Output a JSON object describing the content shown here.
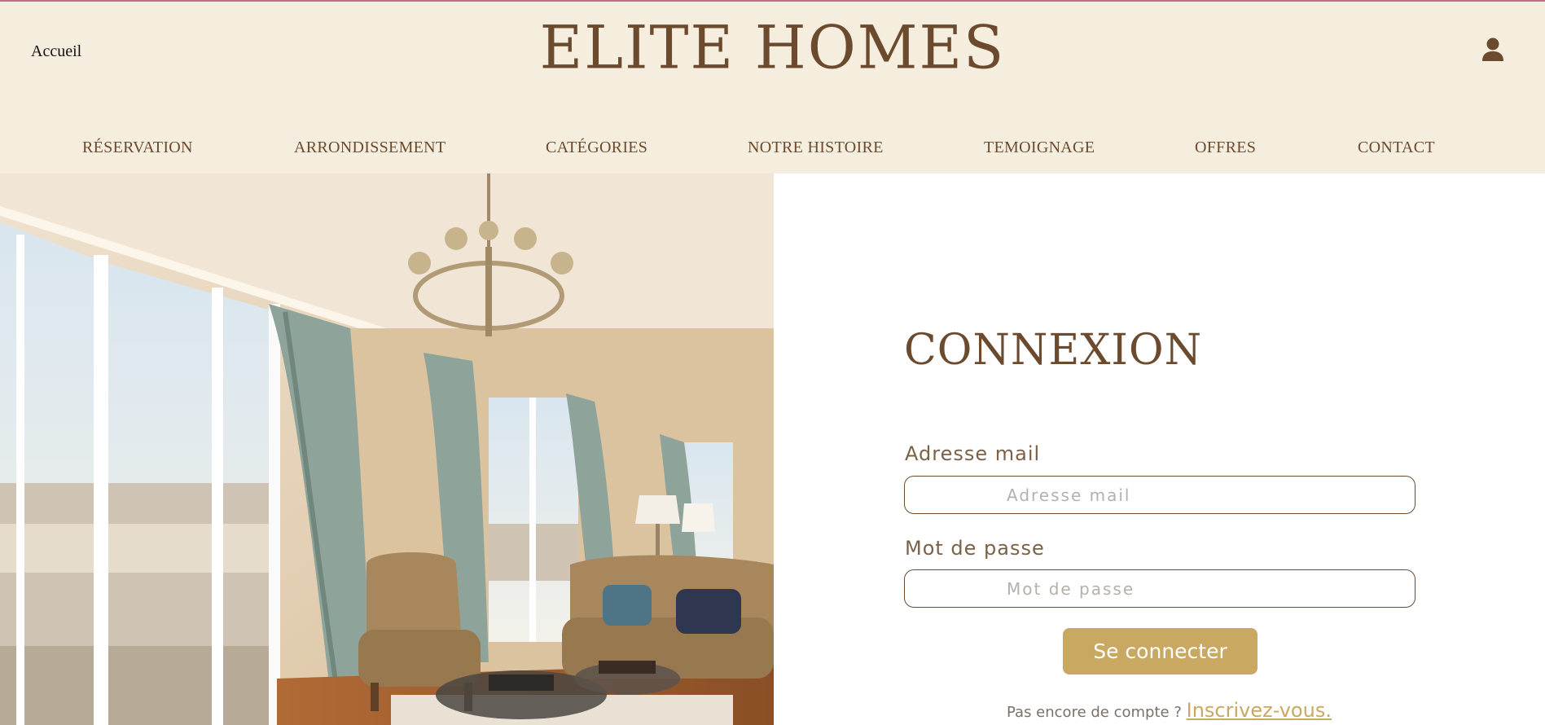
{
  "header": {
    "home_link": "Accueil",
    "logo": "ELITE HOMES",
    "account_icon": "user-icon"
  },
  "nav": {
    "items": [
      {
        "label": "RÉSERVATION"
      },
      {
        "label": "ARRONDISSEMENT"
      },
      {
        "label": "CATÉGORIES"
      },
      {
        "label": "NOTRE HISTOIRE"
      },
      {
        "label": "TEMOIGNAGE"
      },
      {
        "label": "OFFRES"
      },
      {
        "label": "CONTACT"
      }
    ]
  },
  "login": {
    "title": "CONNEXION",
    "email_label": "Adresse mail",
    "email_placeholder": "Adresse mail",
    "email_value": "",
    "password_label": "Mot de passe",
    "password_placeholder": "Mot de passe",
    "password_value": "",
    "submit_label": "Se connecter",
    "signup_prompt": "Pas encore de compte ?",
    "signup_link": "Inscrivez-vous."
  },
  "colors": {
    "header_bg": "#f5eedf",
    "brand_brown": "#6b4a2e",
    "button_gold": "#c9a862",
    "top_line": "#c56a86"
  }
}
